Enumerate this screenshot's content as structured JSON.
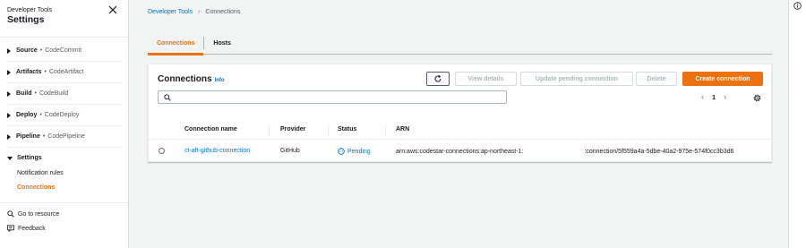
{
  "sidebar": {
    "subtitle": "Developer Tools",
    "title": "Settings",
    "groups": [
      {
        "name": "Source",
        "service": "CodeCommit"
      },
      {
        "name": "Artifacts",
        "service": "CodeArtifact"
      },
      {
        "name": "Build",
        "service": "CodeBuild"
      },
      {
        "name": "Deploy",
        "service": "CodeDeploy"
      },
      {
        "name": "Pipeline",
        "service": "CodePipeline"
      }
    ],
    "settings": {
      "label": "Settings",
      "children": [
        "Notification rules",
        "Connections"
      ]
    },
    "bottom_links": [
      "Go to resource",
      "Feedback"
    ]
  },
  "breadcrumb": {
    "parent": "Developer Tools",
    "current": "Connections"
  },
  "tabs": [
    "Connections",
    "Hosts"
  ],
  "panel": {
    "title": "Connections",
    "info": "Info",
    "buttons": {
      "view": "View details",
      "update": "Update pending connection",
      "delete": "Delete",
      "create": "Create connection"
    },
    "search_value": "",
    "page": "1"
  },
  "table": {
    "headers": [
      "Connection name",
      "Provider",
      "Status",
      "ARN"
    ],
    "rows": [
      {
        "name": "ct-aft-github-connection",
        "provider": "GitHub",
        "status": "Pending",
        "arn_prefix": "arn:aws:codestar-connections:ap-northeast-1:",
        "arn_suffix": ":connection/5f559a4a-5dbe-40a2-975e-574f0cc3b3d6"
      }
    ]
  },
  "colors": {
    "accent": "#ec7211",
    "link": "#0073bb",
    "text": "#16191f"
  }
}
